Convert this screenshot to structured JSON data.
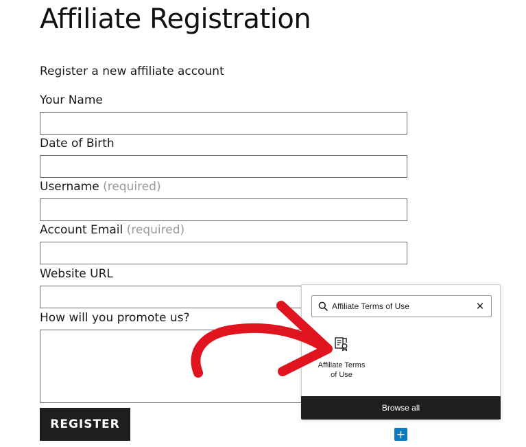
{
  "form": {
    "title": "Affiliate Registration",
    "subtitle": "Register a new affiliate account",
    "fields": [
      {
        "label": "Your Name",
        "required_text": "",
        "value": ""
      },
      {
        "label": "Date of Birth",
        "required_text": "",
        "value": ""
      },
      {
        "label": "Username",
        "required_text": "(required)",
        "value": ""
      },
      {
        "label": "Account Email",
        "required_text": "(required)",
        "value": ""
      },
      {
        "label": "Website URL",
        "required_text": "",
        "value": ""
      },
      {
        "label": "How will you promote us?",
        "required_text": "",
        "value": ""
      }
    ],
    "submit_label": "REGISTER"
  },
  "inserter": {
    "search_value": "Affiliate Terms of Use",
    "clear_icon": "close-icon",
    "search_icon": "search-icon",
    "result": {
      "label": "Affiliate Terms of Use",
      "icon": "terms-document-icon"
    },
    "browse_all_label": "Browse all"
  },
  "add_block_button": {
    "symbol": "+",
    "color": "#0a7ac2"
  },
  "colors": {
    "annotation_arrow": "#e0141e",
    "button_dark": "#1e1e1e",
    "required_text": "#9a9a9a"
  }
}
